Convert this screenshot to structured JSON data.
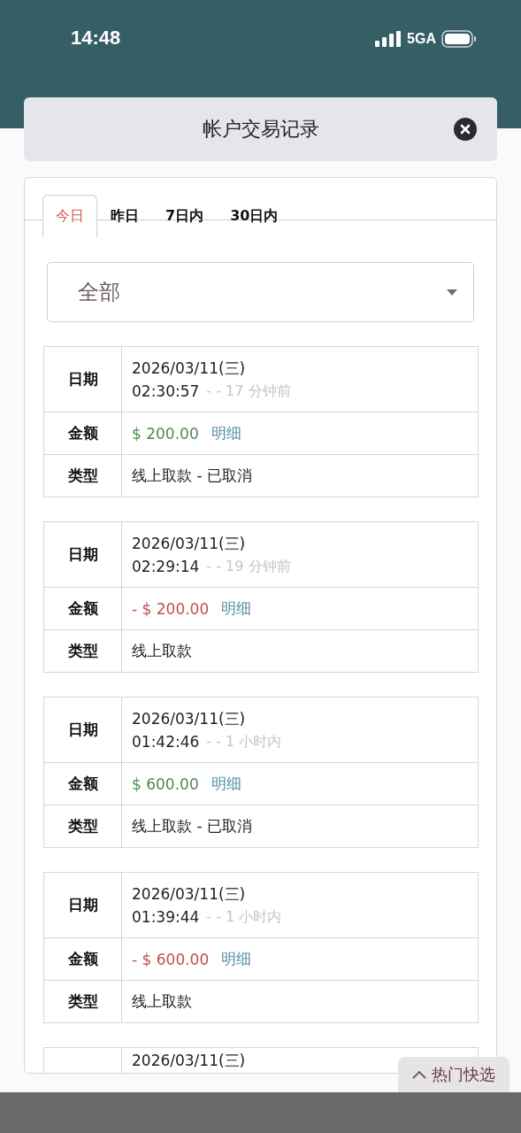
{
  "status_bar": {
    "time": "14:48",
    "network": "5GA"
  },
  "modal": {
    "title": "帐户交易记录"
  },
  "tabs": [
    {
      "label": "今日",
      "selected": true
    },
    {
      "label": "昨日",
      "selected": false
    },
    {
      "label": "7日内",
      "selected": false
    },
    {
      "label": "30日内",
      "selected": false
    }
  ],
  "filter": {
    "value": "全部"
  },
  "records": [
    {
      "labels": {
        "date": "日期",
        "amount": "金额",
        "type": "类型"
      },
      "date": "2026/03/11(三)",
      "time": "02:30:57",
      "relative": "- - 17 分钟前",
      "amount": "$ 200.00",
      "kind": "credit",
      "detail": "明细",
      "type": "线上取款 - 已取消"
    },
    {
      "labels": {
        "date": "日期",
        "amount": "金额",
        "type": "类型"
      },
      "date": "2026/03/11(三)",
      "time": "02:29:14",
      "relative": "- - 19 分钟前",
      "amount": "- $ 200.00",
      "kind": "debit",
      "detail": "明细",
      "type": "线上取款"
    },
    {
      "labels": {
        "date": "日期",
        "amount": "金额",
        "type": "类型"
      },
      "date": "2026/03/11(三)",
      "time": "01:42:46",
      "relative": "- - 1 小时内",
      "amount": "$ 600.00",
      "kind": "credit",
      "detail": "明细",
      "type": "线上取款 - 已取消"
    },
    {
      "labels": {
        "date": "日期",
        "amount": "金额",
        "type": "类型"
      },
      "date": "2026/03/11(三)",
      "time": "01:39:44",
      "relative": "- - 1 小时内",
      "amount": "- $ 600.00",
      "kind": "debit",
      "detail": "明细",
      "type": "线上取款"
    }
  ],
  "partial_record": {
    "date": "2026/03/11(三)"
  },
  "quick_button": {
    "label": "热门快选"
  }
}
